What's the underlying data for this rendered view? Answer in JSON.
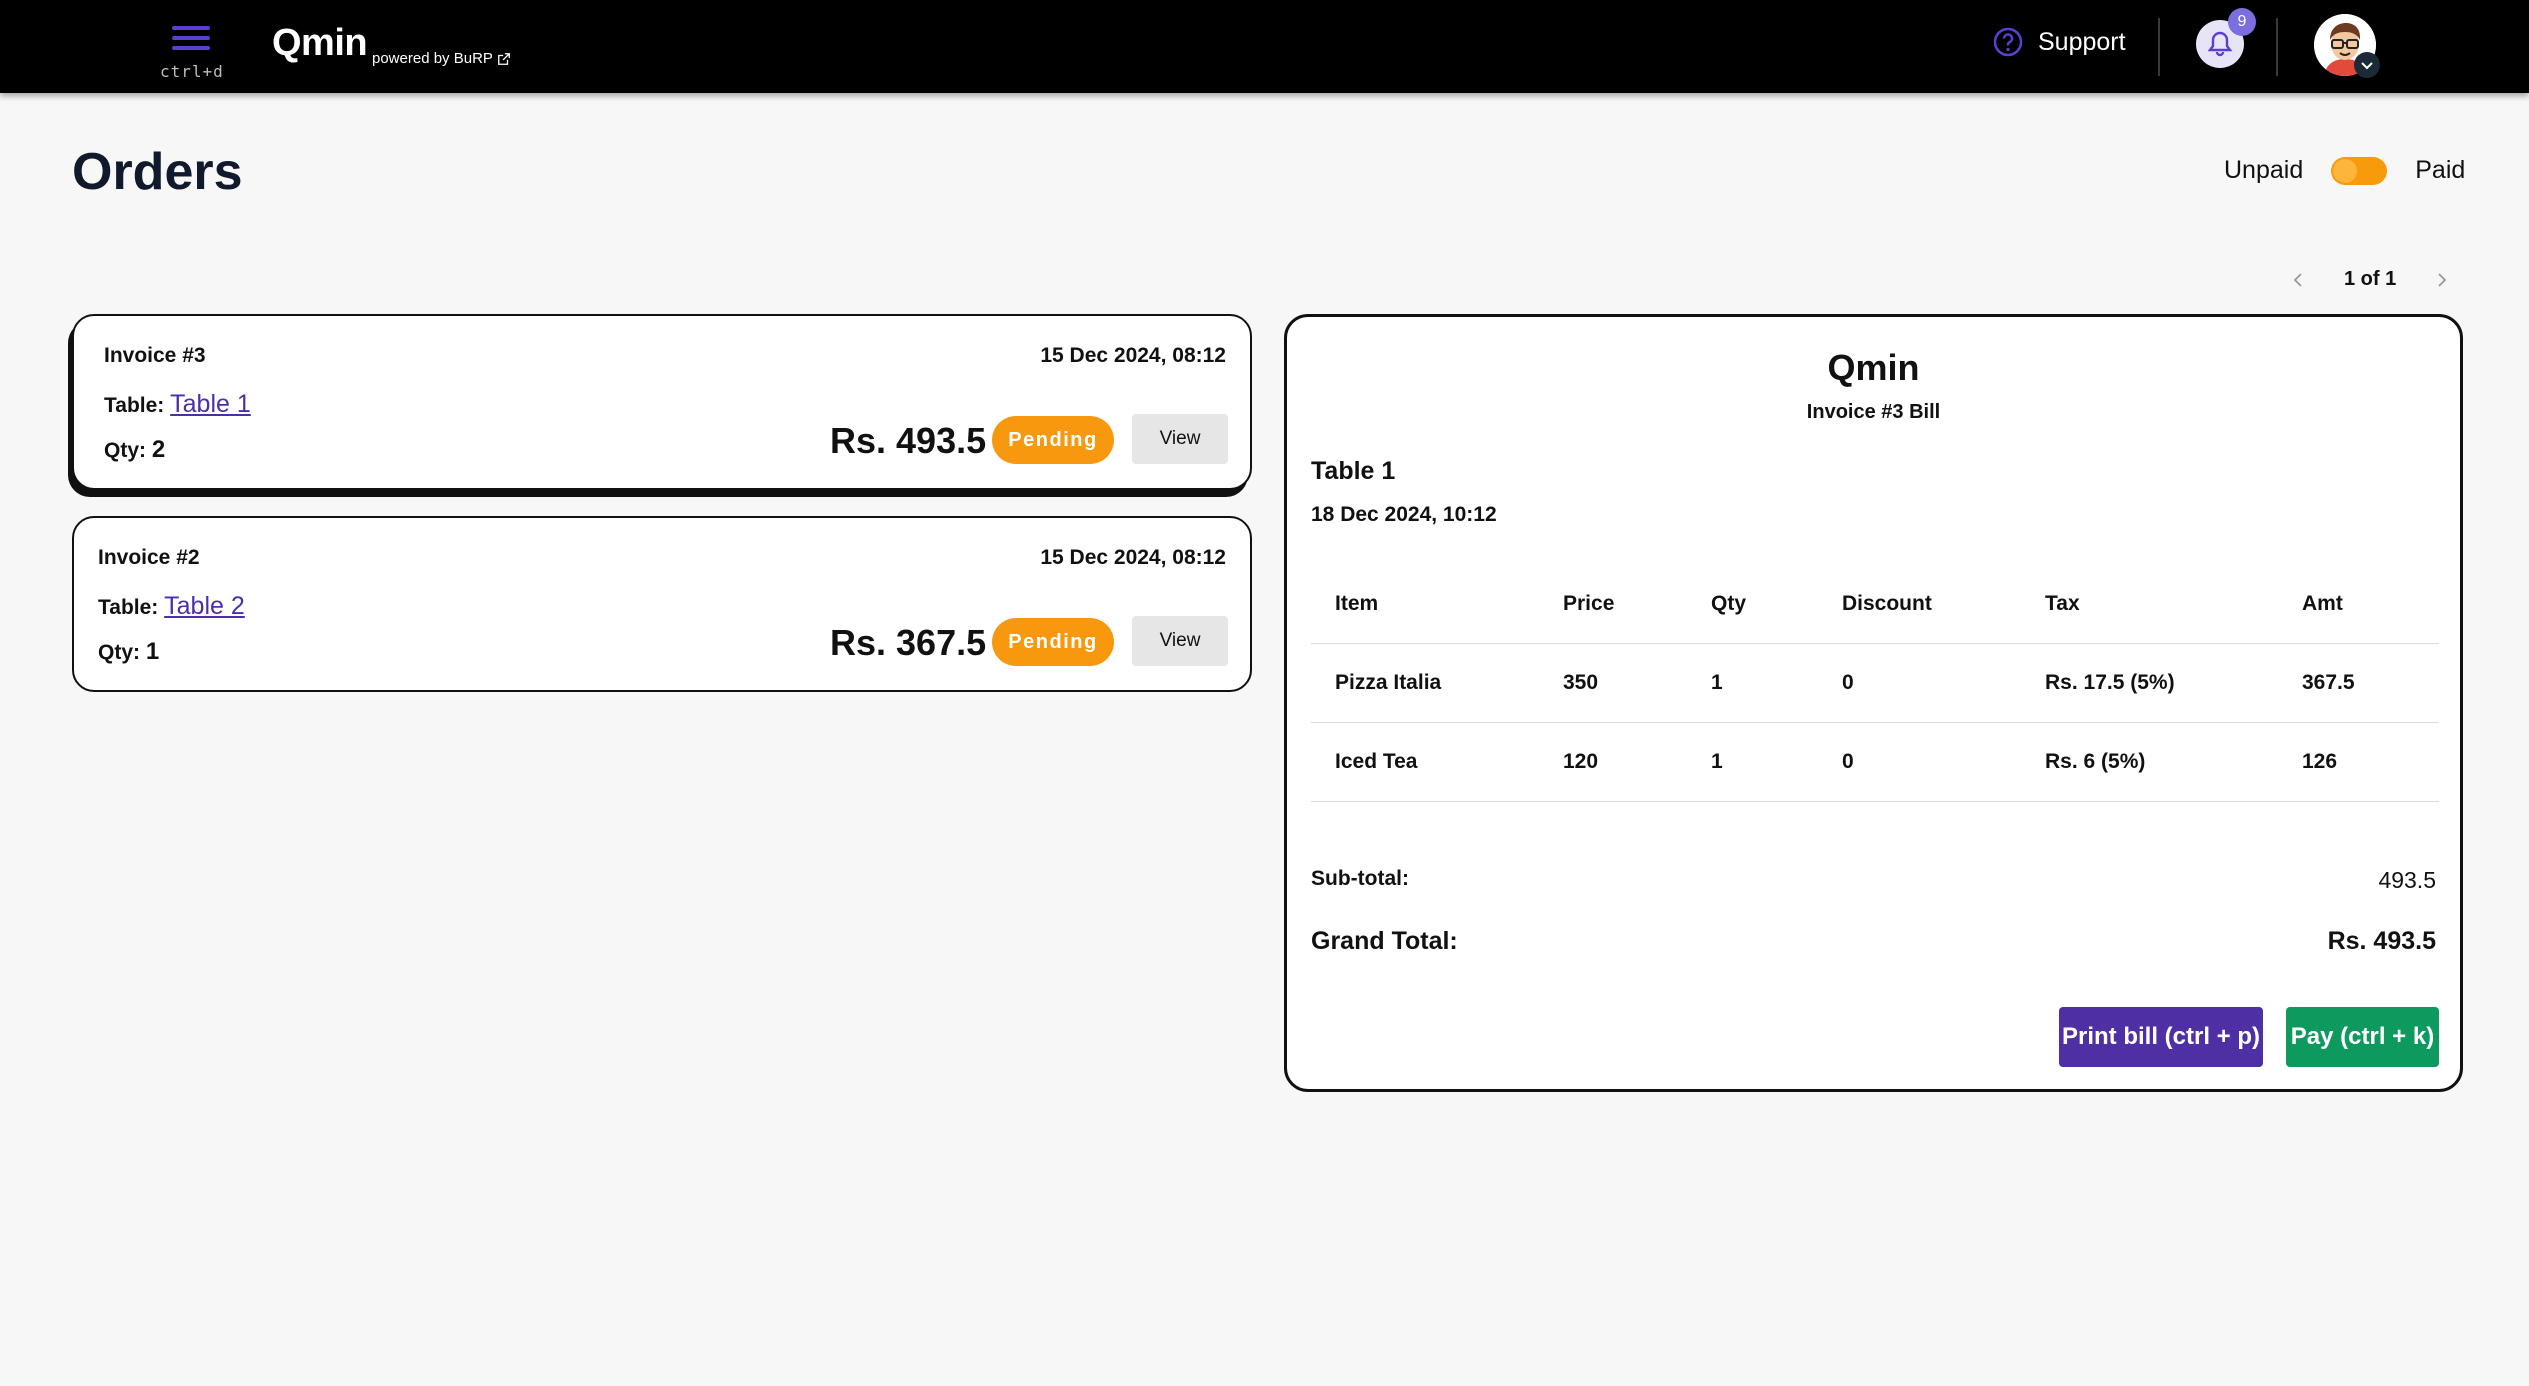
{
  "header": {
    "menu_shortcut": "ctrl+d",
    "brand": "Qmin",
    "powered_by": "powered by BuRP",
    "support_label": "Support",
    "notification_count": "9"
  },
  "page": {
    "title": "Orders",
    "toggle_left": "Unpaid",
    "toggle_right": "Paid",
    "pagination": "1 of 1"
  },
  "invoices": [
    {
      "title": "Invoice #3",
      "date": "15 Dec 2024, 08:12",
      "table_label": "Table:",
      "table_name": "Table 1",
      "qty_label": "Qty:",
      "qty": "2",
      "amount": "Rs. 493.5",
      "status": "Pending",
      "view_label": "View"
    },
    {
      "title": "Invoice #2",
      "date": "15 Dec 2024, 08:12",
      "table_label": "Table:",
      "table_name": "Table 2",
      "qty_label": "Qty:",
      "qty": "1",
      "amount": "Rs. 367.5",
      "status": "Pending",
      "view_label": "View"
    }
  ],
  "bill": {
    "brand": "Qmin",
    "subtitle": "Invoice #3 Bill",
    "table": "Table 1",
    "date": "18 Dec 2024, 10:12",
    "columns": [
      "Item",
      "Price",
      "Qty",
      "Discount",
      "Tax",
      "Amt"
    ],
    "rows": [
      {
        "item": "Pizza Italia",
        "price": "350",
        "qty": "1",
        "discount": "0",
        "tax": "Rs. 17.5 (5%)",
        "amt": "367.5"
      },
      {
        "item": "Iced Tea",
        "price": "120",
        "qty": "1",
        "discount": "0",
        "tax": "Rs. 6 (5%)",
        "amt": "126"
      }
    ],
    "subtotal_label": "Sub-total:",
    "subtotal_value": "493.5",
    "grand_total_label": "Grand Total:",
    "grand_total_value": "Rs. 493.5",
    "print_label": "Print bill (ctrl + p)",
    "pay_label": "Pay (ctrl + k)"
  },
  "colors": {
    "accent": "#4e2fa4",
    "pending": "#f7980f",
    "pay": "#0e9a5f",
    "toggle": "#f79a0c"
  },
  "icons": [
    "hamburger-menu-icon",
    "external-link-icon",
    "help-circle-icon",
    "bell-icon",
    "avatar-icon",
    "chevron-down-icon",
    "chevron-left-icon",
    "chevron-right-icon"
  ]
}
